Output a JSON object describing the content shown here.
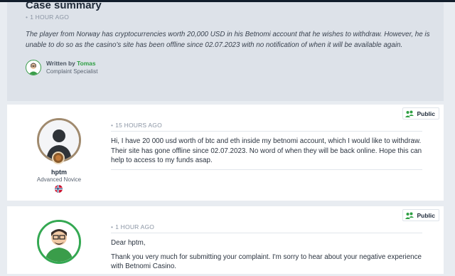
{
  "case_summary": {
    "title": "Case summary",
    "time": "1 HOUR AGO",
    "text": "The player from Norway has cryptocurrencies worth 20,000 USD in his Betnomi account that he wishes to withdraw. However, he is unable to do so as the casino's site has been offline since 02.07.2023 with no notification of when it will be available again.",
    "author": {
      "written_by_label": "Written by",
      "name": "Tomas",
      "role": "Complaint Specialist"
    }
  },
  "posts": [
    {
      "username": "hptm",
      "rank": "Advanced Novice",
      "country": "Norway",
      "visibility": "Public",
      "time": "15 HOURS AGO",
      "body": "Hi, I have 20 000 usd worth of btc and eth inside my betnomi account, which I would like to withdraw. Their site has gone offline since 02.07.2023. No word of when they will be back online. Hope this can help to access to my funds asap."
    },
    {
      "visibility": "Public",
      "time": "1 HOUR AGO",
      "greeting": "Dear hptm,",
      "body": "Thank you very much for submitting your complaint. I'm sorry to hear about your negative experience with Betnomi Casino."
    }
  ],
  "colors": {
    "accent_green": "#2e9f43",
    "panel_bg": "#dde2e9",
    "page_bg": "#e8ecf1"
  }
}
